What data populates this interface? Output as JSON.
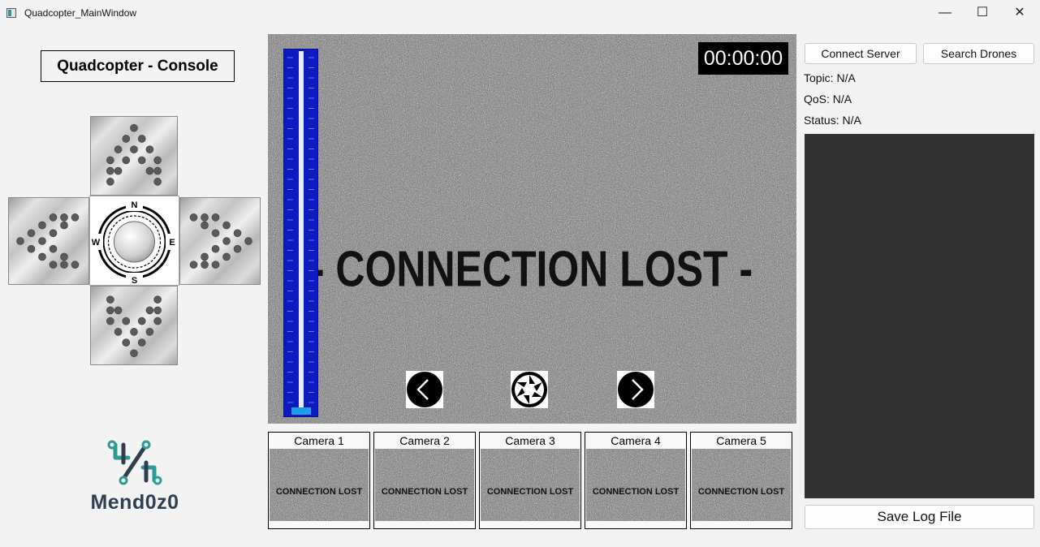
{
  "window": {
    "title": "Quadcopter_MainWindow",
    "controls": {
      "minimize": "—",
      "maximize": "☐",
      "close": "✕"
    }
  },
  "console": {
    "title": "Quadcopter - Console",
    "compass": {
      "north": "N",
      "south": "S",
      "east": "E",
      "west": "W"
    },
    "dpad_icons": {
      "up": "arrow-up-icon",
      "down": "arrow-down-icon",
      "left": "arrow-left-icon",
      "right": "arrow-right-icon"
    }
  },
  "logo": {
    "text": "Mend0z0"
  },
  "video": {
    "timer": "00:00:00",
    "status_text": "- CONNECTION LOST -",
    "throttle_level": 0,
    "controls": {
      "prev": "chevron-left-icon",
      "capture": "camera-shutter-icon",
      "next": "chevron-right-icon"
    }
  },
  "cameras": [
    {
      "label": "Camera 1",
      "feed_text": "CONNECTION LOST"
    },
    {
      "label": "Camera 2",
      "feed_text": "CONNECTION LOST"
    },
    {
      "label": "Camera 3",
      "feed_text": "CONNECTION LOST"
    },
    {
      "label": "Camera 4",
      "feed_text": "CONNECTION LOST"
    },
    {
      "label": "Camera 5",
      "feed_text": "CONNECTION LOST"
    }
  ],
  "server": {
    "connect_label": "Connect Server",
    "search_label": "Search Drones",
    "topic": "Topic: N/A",
    "qos": "QoS: N/A",
    "status": "Status: N/A",
    "save_label": "Save Log File"
  },
  "colors": {
    "throttle": "#0c1ac0",
    "throttle_handle": "#1e9ce6",
    "log_background": "#323232",
    "logo_teal": "#2a9d96",
    "logo_navy": "#2f3f52"
  }
}
